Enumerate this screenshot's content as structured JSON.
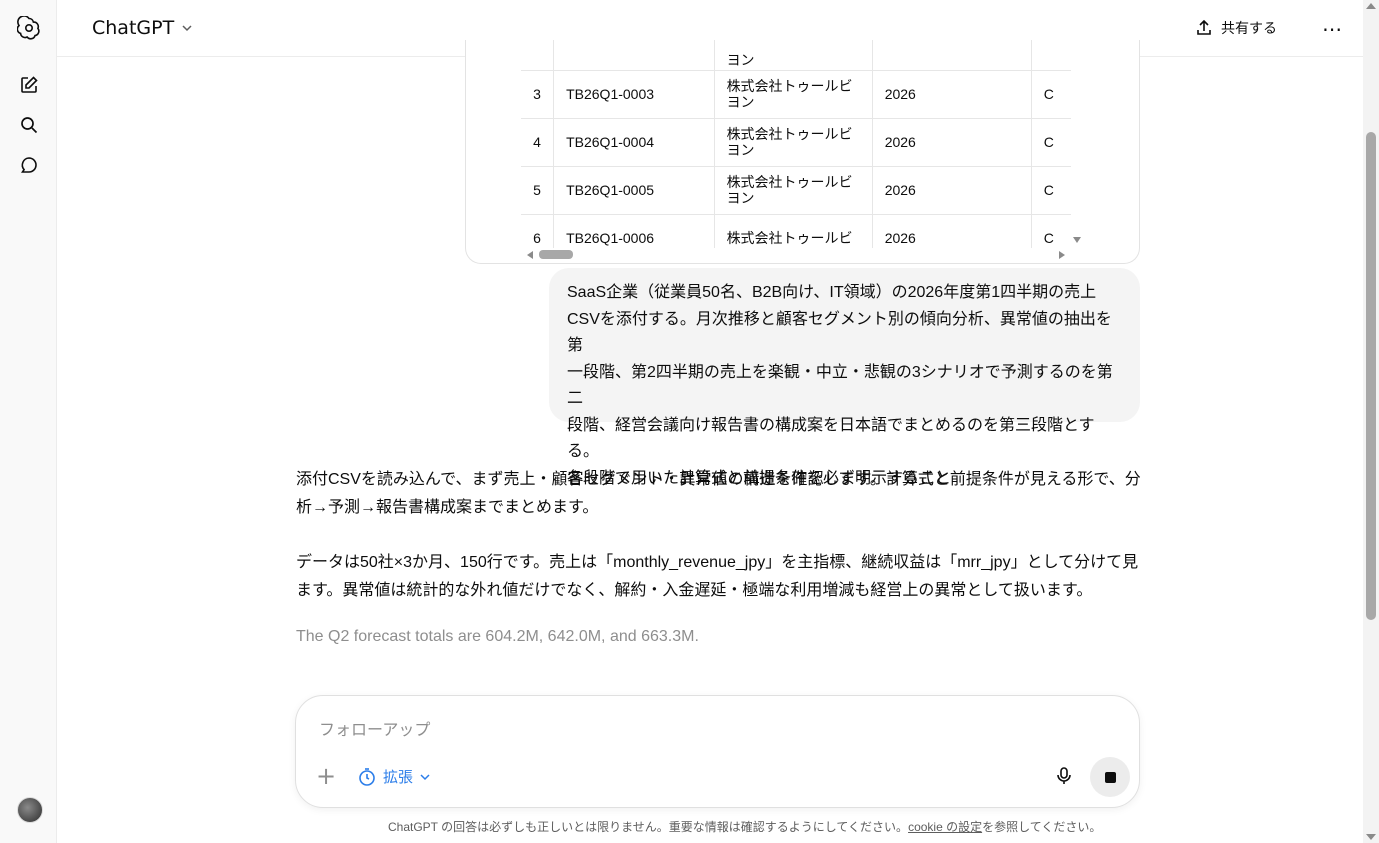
{
  "header": {
    "model_name": "ChatGPT",
    "share_label": "共有する"
  },
  "table": {
    "partial_top_text": "ヨン",
    "rows": [
      {
        "idx": "3",
        "code": "TB26Q1-0003",
        "name": "株式会社トゥールビヨン",
        "year": "2026",
        "cut": "C"
      },
      {
        "idx": "4",
        "code": "TB26Q1-0004",
        "name": "株式会社トゥールビヨン",
        "year": "2026",
        "cut": "C"
      },
      {
        "idx": "5",
        "code": "TB26Q1-0005",
        "name": "株式会社トゥールビヨン",
        "year": "2026",
        "cut": "C"
      },
      {
        "idx": "6",
        "code": "TB26Q1-0006",
        "name": "株式会社トゥールビ",
        "year": "2026",
        "cut": "C"
      }
    ]
  },
  "user_message": {
    "lines": [
      "SaaS企業（従業員50名、B2B向け、IT領域）の2026年度第1四半期の売上",
      "CSVを添付する。月次推移と顧客セグメント別の傾向分析、異常値の抽出を第",
      "一段階、第2四半期の売上を楽観・中立・悲観の3シナリオで予測するのを第二",
      "段階、経営会議向け報告書の構成案を日本語でまとめるのを第三段階とする。",
      "各段階で用いた計算式と前提条件を必ず明示すること"
    ]
  },
  "assistant": {
    "para1": "添付CSVを読み込んで、まず売上・顧客セグメント・異常値の構造を確認します。計算式と前提条件が見える形で、分析→予測→報告書構成案までまとめます。",
    "para2": "データは50社×3か月、150行です。売上は「monthly_revenue_jpy」を主指標、継続収益は「mrr_jpy」として分けて見ます。異常値は統計的な外れ値だけでなく、解約・入金遅延・極端な利用増減も経営上の異常として扱います。",
    "status": "The Q2 forecast totals are 604.2M, 642.0M, and 663.3M."
  },
  "composer": {
    "placeholder": "フォローアップ",
    "mode_label": "拡張"
  },
  "footer": {
    "text_before": "ChatGPT の回答は必ずしも正しいとは限りません。重要な情報は確認するようにしてください。",
    "link": "cookie の設定",
    "text_after": "を参照してください。"
  }
}
